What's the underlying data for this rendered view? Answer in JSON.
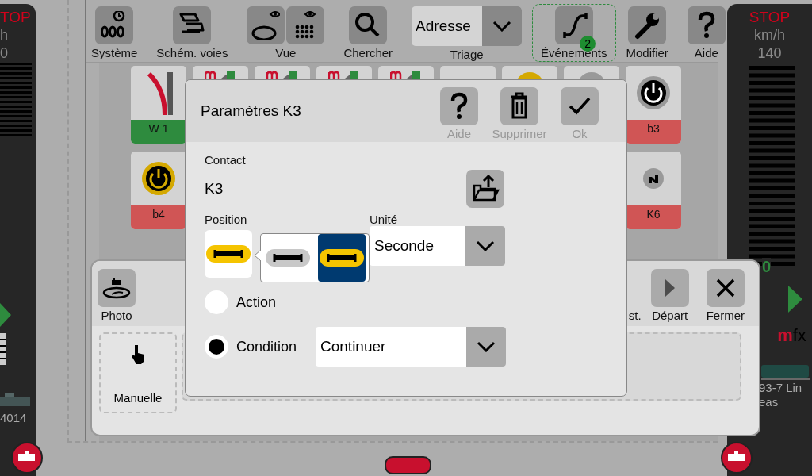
{
  "left_cab": {
    "stop": "TOP",
    "unit": "h",
    "speed": "0",
    "loco_number": "4014"
  },
  "toolbar": [
    {
      "kind": "button",
      "label": "Système",
      "selected": false
    },
    {
      "kind": "button",
      "label": "Schém. voies",
      "selected": false
    },
    {
      "kind": "double",
      "label": "Vue",
      "selected": false
    },
    {
      "kind": "button",
      "label": "Chercher",
      "selected": false
    },
    {
      "kind": "dropdown",
      "label": "Triage",
      "value": "Adresse",
      "selected": false
    },
    {
      "kind": "button",
      "label": "Événements",
      "badge": "2",
      "selected": true
    },
    {
      "kind": "button",
      "label": "Modifier",
      "selected": false
    },
    {
      "kind": "button",
      "label": "Aide",
      "selected": false
    }
  ],
  "tiles": [
    [
      {
        "kind": "turnout",
        "label": "W 1",
        "color": "#2e8b3e"
      },
      {
        "kind": "signal"
      },
      {
        "kind": "signal"
      },
      {
        "kind": "signal"
      },
      {
        "kind": "signal"
      },
      {
        "kind": "blank"
      },
      {
        "kind": "lamp-on"
      },
      {
        "kind": "lamp-off"
      },
      {
        "kind": "power-off",
        "label": "b3",
        "color": "#d05555"
      }
    ],
    [
      {
        "kind": "power-on",
        "label": "b4",
        "color": "#d05555"
      },
      {
        "kind": "hidden"
      },
      {
        "kind": "hidden"
      },
      {
        "kind": "hidden"
      },
      {
        "kind": "hidden"
      },
      {
        "kind": "hidden"
      },
      {
        "kind": "hidden"
      },
      {
        "kind": "hidden"
      },
      {
        "kind": "contact",
        "label": "K6",
        "color": "#d05555"
      }
    ]
  ],
  "right_cab": {
    "stop": "STOP",
    "unit": "km/h",
    "max_speed": "140",
    "speed": "0",
    "decoder": "mfx",
    "loco_name_lines": [
      "93-7 Lin",
      "eas"
    ]
  },
  "bottom_panel": {
    "buttons": [
      {
        "label": "Photo",
        "disabled": false
      },
      {
        "label": "st."
      },
      {
        "label": "Départ",
        "disabled": true
      },
      {
        "label": "Fermer",
        "disabled": false
      }
    ],
    "modes": [
      {
        "label": "Manuelle"
      }
    ]
  },
  "dialog": {
    "title": "Paramètres K3",
    "buttons": [
      {
        "label": "Aide"
      },
      {
        "label": "Supprimer"
      },
      {
        "label": "Ok"
      }
    ],
    "contact_label": "Contact",
    "contact_value": "K3",
    "position_label": "Position",
    "unit_label": "Unité",
    "unit_value": "Seconde",
    "radios": [
      {
        "label": "Action",
        "selected": false
      },
      {
        "label": "Condition",
        "selected": true,
        "value": "Continuer"
      }
    ]
  },
  "position_popup": {
    "options": [
      {
        "kind": "off",
        "selected": false
      },
      {
        "kind": "on",
        "selected": true
      }
    ]
  }
}
